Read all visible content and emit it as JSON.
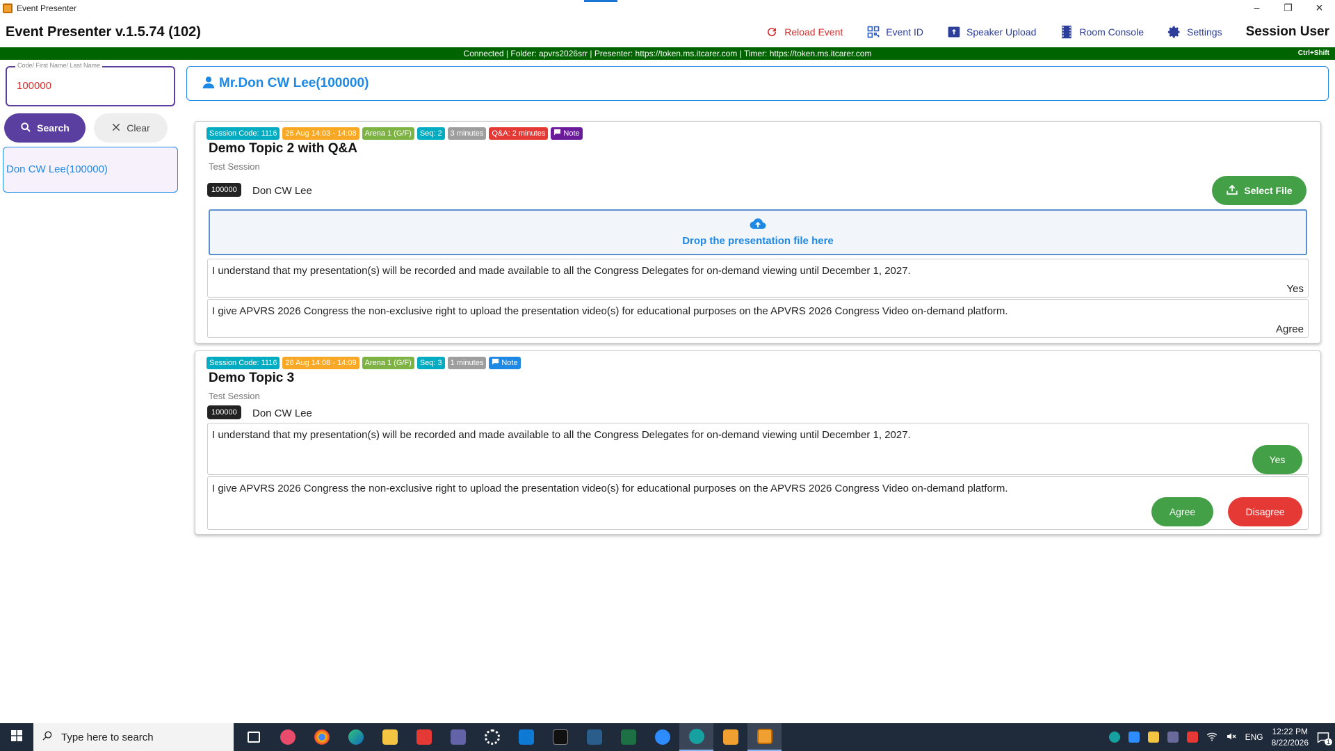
{
  "window": {
    "title": "Event Presenter",
    "minimize": "–",
    "restore": "❐",
    "close": "✕"
  },
  "appbar": {
    "title": "Event Presenter v.1.5.74 (102)",
    "toolbar": {
      "reload": "Reload Event",
      "event_id": "Event ID",
      "speaker_upload": "Speaker Upload",
      "room_console": "Room Console",
      "settings": "Settings"
    },
    "session_user": "Session User"
  },
  "status": {
    "text": "Connected | Folder: apvrs2026srr | Presenter: https://token.ms.itcarer.com | Timer: https://token.ms.itcarer.com",
    "shortcut": "Ctrl+Shift"
  },
  "search": {
    "label": "Code/ First Name/ Last Name",
    "value": "100000",
    "search_button": "Search",
    "clear_button": "Clear",
    "results": [
      "Don CW Lee(100000)"
    ]
  },
  "speaker": {
    "name": "Mr.Don CW Lee(100000)"
  },
  "sessions": [
    {
      "badges": {
        "code": "Session Code: 1116",
        "time": "26 Aug 14:03 - 14:08",
        "room": "Arena 1 (G/F)",
        "seq": "Seq: 2",
        "duration": "3 minutes",
        "qa": "Q&A: 2 minutes",
        "note": "Note"
      },
      "title": "Demo Topic 2 with Q&A",
      "subtitle": "Test Session",
      "presenter_code": "100000",
      "presenter_name": "Don CW Lee",
      "select_file": "Select File",
      "dropzone": "Drop the presentation file here",
      "consents": [
        {
          "text": "I understand that my presentation(s) will be recorded and made available to all the Congress Delegates for on-demand viewing until December 1, 2027.",
          "answer": "Yes"
        },
        {
          "text": "I give APVRS 2026 Congress the non-exclusive right to upload the presentation video(s) for educational purposes on the APVRS 2026 Congress Video on-demand platform.",
          "answer": "Agree"
        }
      ]
    },
    {
      "badges": {
        "code": "Session Code: 1116",
        "time": "26 Aug 14:08 - 14:09",
        "room": "Arena 1 (G/F)",
        "seq": "Seq: 3",
        "duration": "1 minutes",
        "note": "Note"
      },
      "title": "Demo Topic 3",
      "subtitle": "Test Session",
      "presenter_code": "100000",
      "presenter_name": "Don CW Lee",
      "consents": [
        {
          "text": "I understand that my presentation(s) will be recorded and made available to all the Congress Delegates for on-demand viewing until December 1, 2027.",
          "yes_button": "Yes"
        },
        {
          "text": "I give APVRS 2026 Congress the non-exclusive right to upload the presentation video(s) for educational purposes on the APVRS 2026 Congress Video on-demand platform.",
          "agree_button": "Agree",
          "disagree_button": "Disagree"
        }
      ]
    }
  ],
  "taskbar": {
    "search_placeholder": "Type here to search",
    "language": "ENG",
    "time": "12:22 PM",
    "date": "8/22/2026",
    "notifications": "1"
  },
  "colors": {
    "accent_purple": "#5b3fa0",
    "accent_blue": "#1e88e5",
    "status_green": "#006400",
    "success": "#43a047",
    "danger": "#e53935"
  }
}
